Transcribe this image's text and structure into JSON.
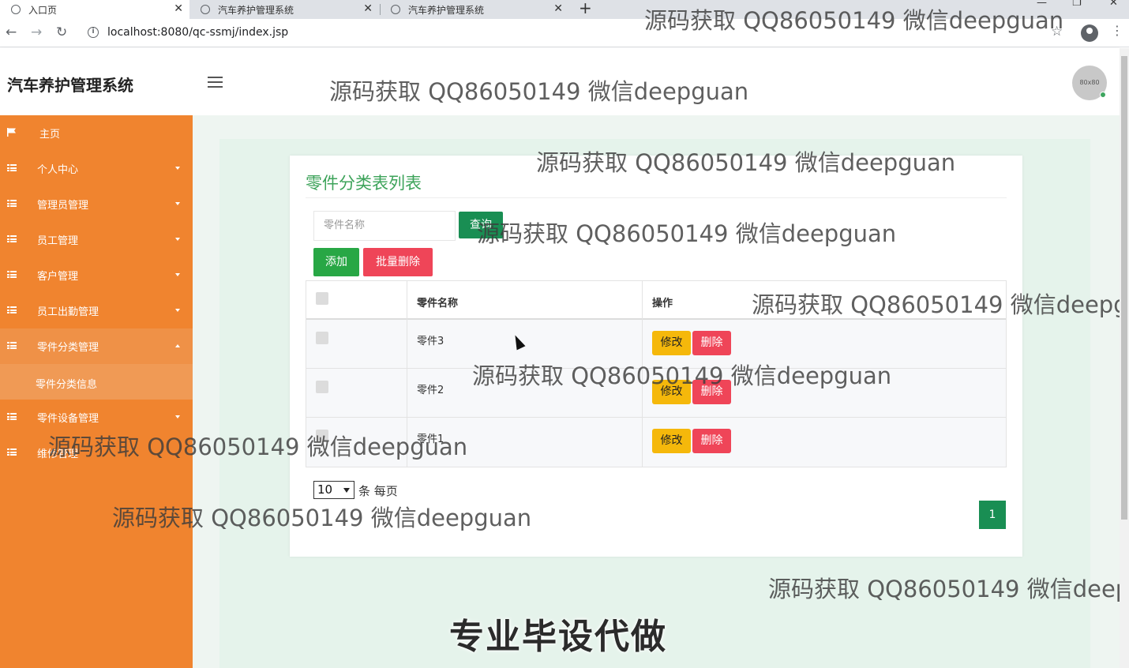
{
  "browser": {
    "tabs": [
      {
        "title": "入口页",
        "active": true
      },
      {
        "title": "汽车养护管理系统",
        "active": false
      },
      {
        "title": "汽车养护管理系统",
        "active": false
      }
    ],
    "url": "localhost:8080/qc-ssmj/index.jsp"
  },
  "app": {
    "title": "汽车养护管理系统",
    "avatar_text": "80x80"
  },
  "sidebar": {
    "items": [
      {
        "label": "主页",
        "icon": "flag-icon"
      },
      {
        "label": "个人中心",
        "icon": "grid-icon"
      },
      {
        "label": "管理员管理",
        "icon": "grid-icon"
      },
      {
        "label": "员工管理",
        "icon": "grid-icon"
      },
      {
        "label": "客户管理",
        "icon": "grid-icon"
      },
      {
        "label": "员工出勤管理",
        "icon": "grid-icon"
      },
      {
        "label": "零件分类管理",
        "icon": "grid-icon",
        "open": true
      },
      {
        "label": "零件设备管理",
        "icon": "grid-icon"
      },
      {
        "label": "维修管理",
        "icon": "grid-icon"
      }
    ],
    "subitem": "零件分类信息",
    "color": "#f0842f"
  },
  "panel": {
    "title": "零件分类表列表",
    "search_placeholder": "零件名称",
    "search_button": "查询",
    "add_button": "添加",
    "bulk_delete_button": "批量删除",
    "columns": [
      "零件名称",
      "操作"
    ],
    "rows": [
      {
        "name": "零件3"
      },
      {
        "name": "零件2"
      },
      {
        "name": "零件1"
      }
    ],
    "edit_label": "修改",
    "delete_label": "删除",
    "page_size": "10",
    "page_size_label": "条 每页",
    "current_page": "1",
    "accent_color": "#3da35a"
  },
  "watermarks": {
    "text": "源码获取 QQ86050149 微信deepguan",
    "partial_1": "源码获取 QQ86050149 微信deepg",
    "partial_2": "源码获取 QQ86050149 微信deep",
    "banner": "专业毕设代做"
  }
}
